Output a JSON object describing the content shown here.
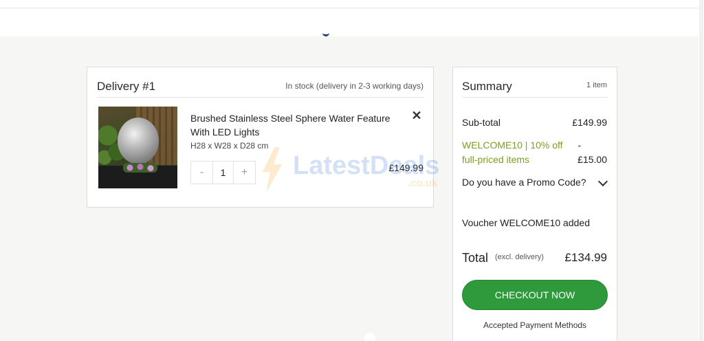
{
  "delivery": {
    "title": "Delivery #1",
    "stock_status": "In stock (delivery in 2-3 working days)",
    "item": {
      "name": "Brushed Stainless Steel Sphere Water Feature With LED Lights",
      "dimensions": "H28 x W28 x D28 cm",
      "remove_symbol": "✕",
      "quantity": "1",
      "minus_symbol": "-",
      "plus_symbol": "+",
      "price": "£149.99"
    }
  },
  "watermark": {
    "text": "LatestDeals",
    "suffix": ".co.uk"
  },
  "summary": {
    "title": "Summary",
    "item_count": "1 item",
    "subtotal_label": "Sub-total",
    "subtotal_value": "£149.99",
    "discount_label": "WELCOME10 | 10% off full-priced items",
    "discount_sign": "-",
    "discount_value": "£15.00",
    "promo_label": "Do you have a Promo Code?",
    "voucher_message": "Voucher WELCOME10 added",
    "total_label": "Total",
    "total_note": "(excl. delivery)",
    "total_value": "£134.99",
    "checkout_label": "CHECKOUT NOW",
    "payment_label": "Accepted Payment Methods"
  },
  "colors": {
    "accent_green": "#2e9a3c",
    "discount_green": "#7a9e1f",
    "brand_navy": "#1d3b6e"
  },
  "icons": [
    "close-icon",
    "chevron-down-icon",
    "minus-icon",
    "plus-icon"
  ]
}
